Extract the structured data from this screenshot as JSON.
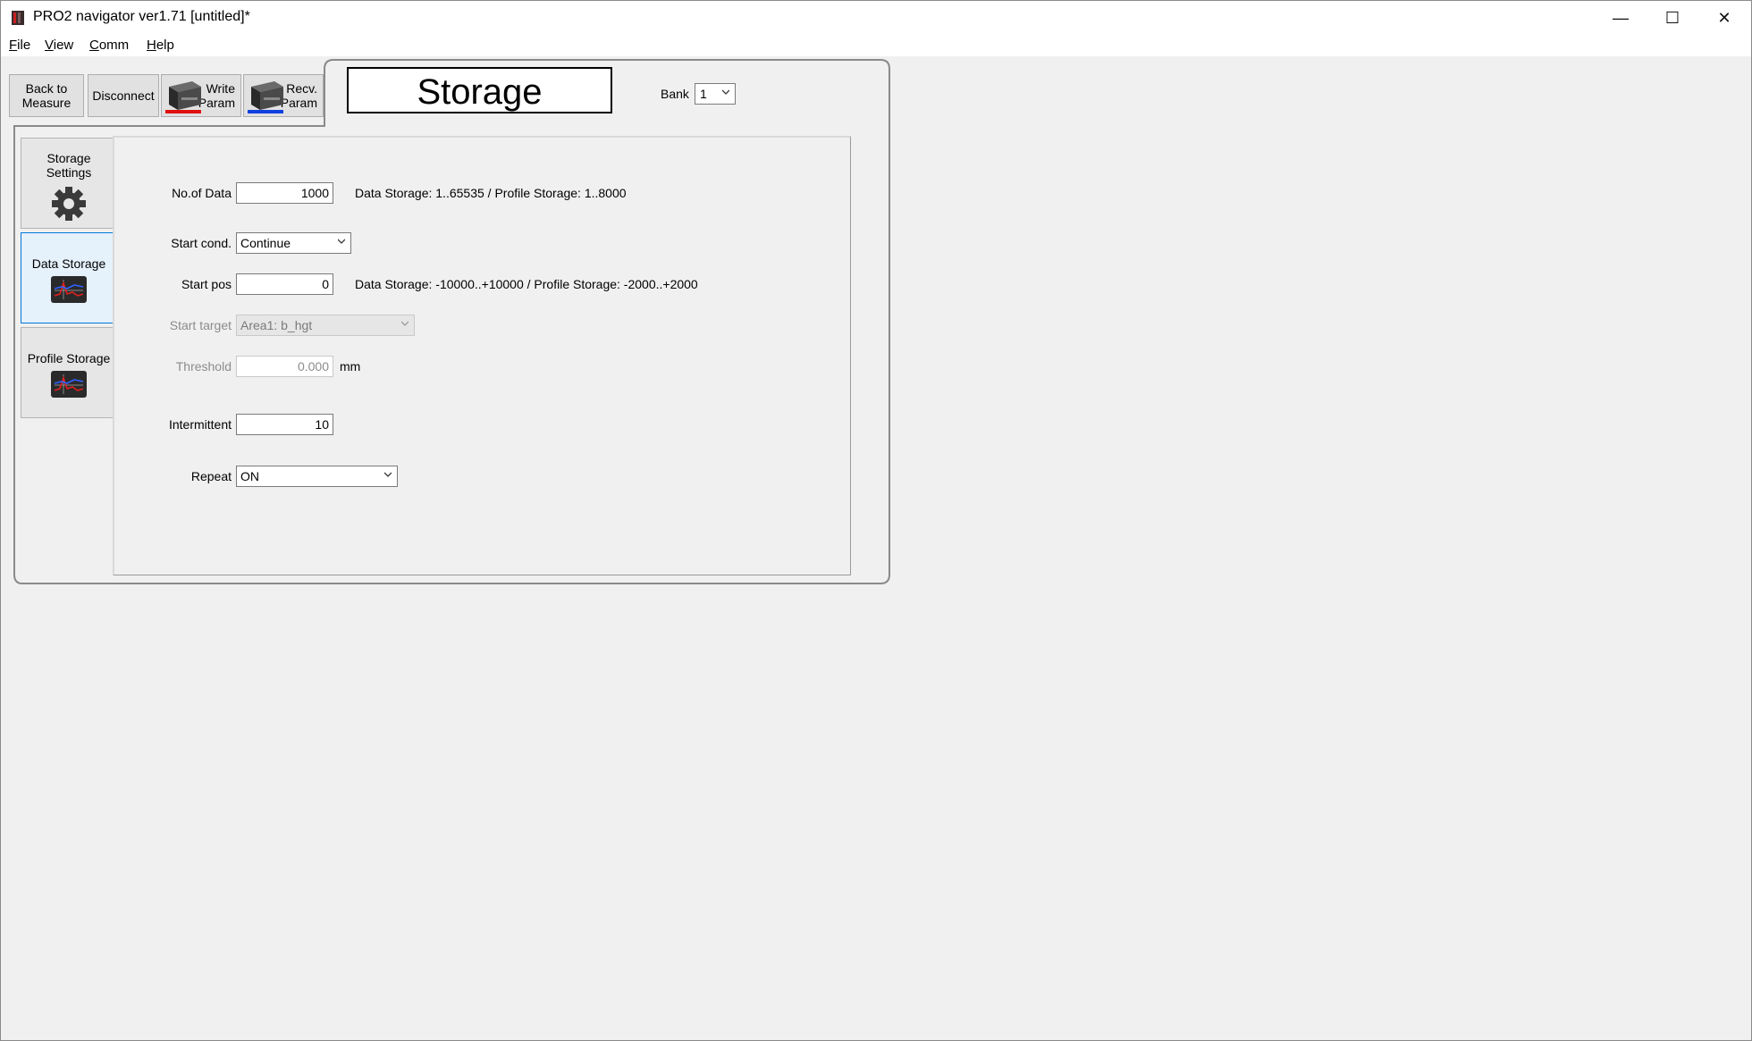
{
  "window": {
    "title": "PRO2 navigator ver1.71 [untitled]*",
    "minimize": "—",
    "maximize": "☐",
    "close": "✕"
  },
  "menu": [
    {
      "label": "File",
      "mnemonic": "F",
      "rest": "ile"
    },
    {
      "label": "View",
      "mnemonic": "V",
      "rest": "iew"
    },
    {
      "label": "Comm",
      "mnemonic": "C",
      "rest": "omm"
    },
    {
      "label": "Help",
      "mnemonic": "H",
      "rest": "elp"
    }
  ],
  "toolbar": {
    "back_line1": "Back to",
    "back_line2": "Measure",
    "disconnect": "Disconnect",
    "write_line1": "Write",
    "write_line2": "Param",
    "recv_line1": "Recv.",
    "recv_line2": "Param"
  },
  "page_title": "Storage",
  "bank": {
    "label": "Bank",
    "value": "1"
  },
  "side_tabs": [
    {
      "line1": "Storage",
      "line2": "Settings",
      "icon": "gear-icon"
    },
    {
      "line1": "Data Storage",
      "line2": "",
      "icon": "waveform-icon",
      "active": true
    },
    {
      "line1": "Profile Storage",
      "line2": "",
      "icon": "waveform-icon"
    }
  ],
  "form": {
    "no_of_data": {
      "label": "No.of Data",
      "value": "1000",
      "hint": "Data Storage: 1..65535 / Profile Storage: 1..8000"
    },
    "start_cond": {
      "label": "Start cond.",
      "value": "Continue"
    },
    "start_pos": {
      "label": "Start pos",
      "value": "0",
      "hint": "Data Storage: -10000..+10000 / Profile Storage: -2000..+2000"
    },
    "start_target": {
      "label": "Start target",
      "value": "Area1: b_hgt"
    },
    "threshold": {
      "label": "Threshold",
      "value": "0.000",
      "unit": "mm"
    },
    "intermittent": {
      "label": "Intermittent",
      "value": "10"
    },
    "repeat": {
      "label": "Repeat",
      "value": "ON"
    }
  }
}
